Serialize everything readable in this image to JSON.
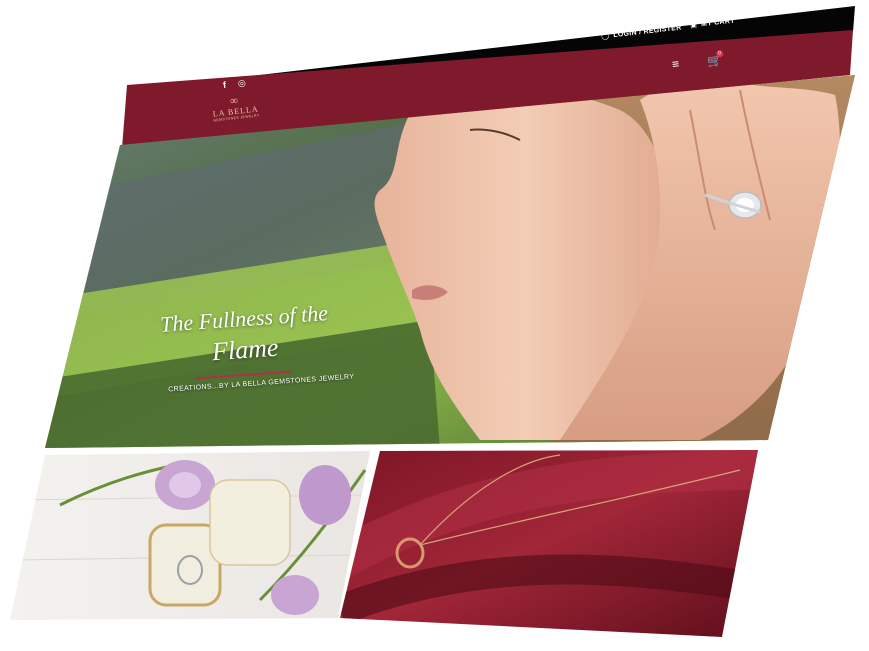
{
  "header": {
    "login_label": "LOGIN / REGISTER",
    "cart_label": "MY CART",
    "cart_count": "0"
  },
  "social": {
    "facebook": "f",
    "instagram": "◎"
  },
  "logo": {
    "name": "LA BELLA",
    "tagline": "GEMSTONES JEWELRY"
  },
  "hero": {
    "title_line1": "The Fullness of the",
    "title_line2": "Flame",
    "subtitle": "CREATIONS...BY LA BELLA GEMSTONES JEWELRY"
  },
  "colors": {
    "black_bar": "#050505",
    "maroon": "#7f1a2c",
    "maroon_dark": "#5a0f1d",
    "cream": "#f1eedf",
    "lavender": "#c8a5d3"
  },
  "icons": [
    "user-icon",
    "bag-icon",
    "menu-icon",
    "cart-icon",
    "facebook-icon",
    "instagram-icon"
  ]
}
